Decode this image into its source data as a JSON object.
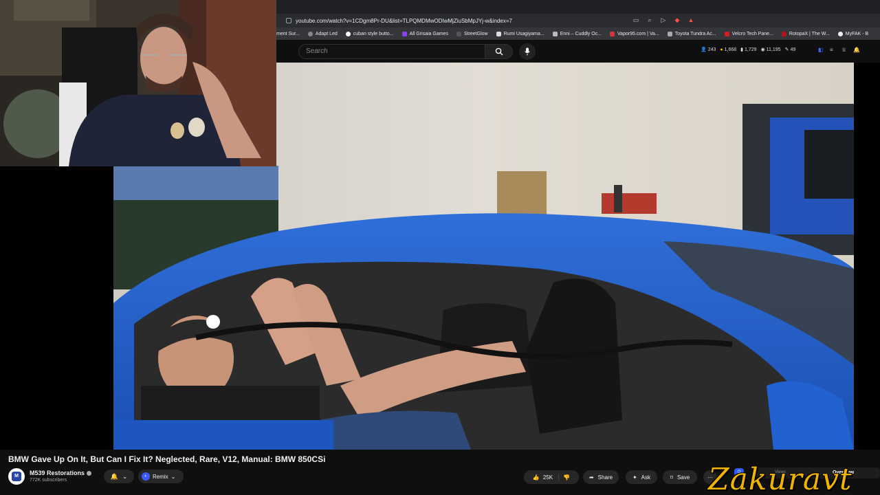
{
  "browser": {
    "url": "youtube.com/watch?v=1CDgm8Pr-DU&list=TLPQMDMwODIwMjZiuSbMpJYj-w&index=7",
    "bookmarks": [
      "ment Sur...",
      "Adapt Led",
      "cuban style butto...",
      "All Grisaia Games",
      "StreetGlow",
      "Rumi Usagiyama...",
      "Enni – Cuddly Oc...",
      "Vapor95.com | Va...",
      "Toyota Tundra Ac...",
      "Velcro Tech Pane...",
      "RotopaX | The W...",
      "MyFAK - B"
    ]
  },
  "header": {
    "search_placeholder": "Search",
    "stats": [
      "243",
      "1,668",
      "1,729",
      "11,195",
      "49"
    ]
  },
  "video": {
    "title": "BMW Gave Up On It, But Can I Fix It? Neglected, Rare, V12, Manual: BMW 850CSi"
  },
  "channel": {
    "name": "M539 Restorations",
    "subscribers": "772K subscribers",
    "remix_label": "Remix"
  },
  "actions": {
    "likes": "25K",
    "share": "Share",
    "ask": "Ask",
    "save": "Save"
  },
  "panel": {
    "badge": "Q",
    "tab_views": "Views",
    "tab_overview": "Overview"
  },
  "overlay": {
    "watermark": "Zakuravt"
  },
  "colors": {
    "background": "#0f0f0f",
    "car_blue": "#1f58c4",
    "watermark": "#f0b400",
    "badge": "#2d5bff"
  }
}
